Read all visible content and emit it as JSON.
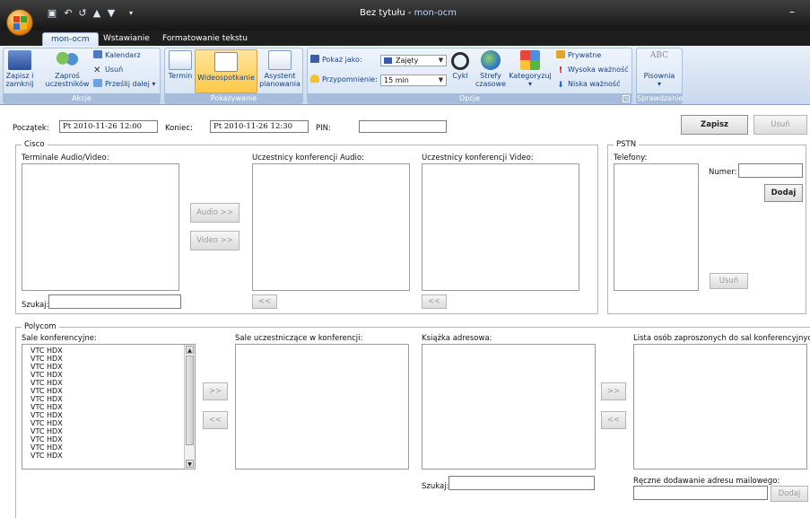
{
  "window": {
    "title": "Bez tytułu - ",
    "app_name": "mon-ocm"
  },
  "qat": {
    "save_icon": "save-icon",
    "undo_icon": "undo-icon",
    "redo_icon": "redo-icon",
    "prev_icon": "up-arrow-icon",
    "next_icon": "down-arrow-icon",
    "customize_icon": "dropdown-icon"
  },
  "tabs": [
    {
      "label": "mon-ocm",
      "active": true
    },
    {
      "label": "Wstawianie",
      "active": false
    },
    {
      "label": "Formatowanie tekstu",
      "active": false
    }
  ],
  "ribbon": {
    "akcje": {
      "label": "Akcje",
      "save_close": [
        "Zapisz i",
        "zamknij"
      ],
      "invite": [
        "Zaproś",
        "uczestników"
      ],
      "calendar": "Kalendarz",
      "delete": "Usuń",
      "forward": "Prześlij dalej"
    },
    "pokazywanie": {
      "label": "Pokazywanie",
      "termin": "Termin",
      "wideospotkanie": "Wideospotkanie",
      "asystent": [
        "Asystent",
        "planowania"
      ]
    },
    "opcje": {
      "label": "Opcje",
      "show_as_label": "Pokaż jako:",
      "show_as_value": "Zajęty",
      "reminder_label": "Przypomnienie:",
      "reminder_value": "15 min",
      "cykl": "Cykl",
      "strefy": [
        "Strefy",
        "czasowe"
      ],
      "kategoryzuj": "Kategoryzuj",
      "prywatne": "Prywatne",
      "wysoka": "Wysoka ważność",
      "niska": "Niska ważność"
    },
    "sprawdzanie": {
      "label": "Sprawdzanie",
      "pisownia": "Pisownia",
      "abc": "ABC"
    }
  },
  "form": {
    "start_label": "Początek:",
    "start_value": "Pt 2010-11-26 12:00",
    "end_label": "Koniec:",
    "end_value": "Pt 2010-11-26 12:30",
    "pin_label": "PIN:",
    "pin_value": "",
    "save_button": "Zapisz",
    "delete_button": "Usuń"
  },
  "cisco": {
    "legend": "Cisco",
    "terminals_label": "Terminale Audio/Video:",
    "audio_button": "Audio >>",
    "video_button": "Video >>",
    "audio_participants_label": "Uczestnicy konferencji Audio:",
    "video_participants_label": "Uczestnicy konferencji Video:",
    "search_label": "Szukaj:",
    "remove_audio_button": "<<",
    "remove_video_button": "<<"
  },
  "pstn": {
    "legend": "PSTN",
    "phones_label": "Telefony:",
    "number_label": "Numer:",
    "add_button": "Dodaj",
    "delete_button": "Usuń"
  },
  "polycom": {
    "legend": "Polycom",
    "rooms_label": "Sale konferencyjne:",
    "rooms": [
      "VTC HDX",
      "VTC HDX",
      "VTC HDX",
      "VTC HDX",
      "VTC HDX",
      "VTC HDX",
      "VTC HDX",
      "VTC HDX",
      "VTC HDX",
      "VTC HDX",
      "VTC HDX",
      "VTC HDX",
      "VTC HDX",
      "VTC HDX"
    ],
    "participating_label": "Sale uczestniczące w konferencji:",
    "addressbook_label": "Książka adresowa:",
    "invited_label": "Lista osób zaproszonych do sal konferencyjnych:",
    "add_room_button": ">>",
    "remove_room_button": "<<",
    "add_person_button": ">>",
    "remove_person_button": "<<",
    "search_label": "Szukaj:",
    "manual_email_label": "Ręczne dodawanie adresu mailowego:",
    "manual_add_button": "Dodaj"
  }
}
